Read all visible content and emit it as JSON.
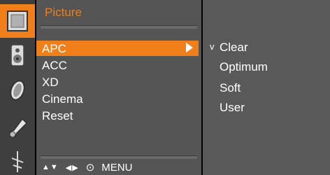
{
  "rail": {
    "icons": [
      {
        "name": "picture-icon",
        "active": true
      },
      {
        "name": "speaker-icon",
        "active": false
      },
      {
        "name": "clock-icon",
        "active": false
      },
      {
        "name": "wrench-icon",
        "active": false
      },
      {
        "name": "antenna-icon",
        "active": false
      }
    ],
    "accent_color": "#f07f1a"
  },
  "panel": {
    "title": "Picture",
    "items": [
      {
        "label": "APC",
        "selected": true
      },
      {
        "label": "ACC",
        "selected": false
      },
      {
        "label": "XD",
        "selected": false
      },
      {
        "label": "Cinema",
        "selected": false
      },
      {
        "label": "Reset",
        "selected": false
      }
    ],
    "nav_hint": {
      "updown": "▲▼",
      "leftright": "◀▶",
      "ok": "⊙",
      "menu": "MENU"
    }
  },
  "submenu": {
    "check_glyph": "v",
    "items": [
      {
        "label": "Clear",
        "checked": true
      },
      {
        "label": "Optimum",
        "checked": false
      },
      {
        "label": "Soft",
        "checked": false
      },
      {
        "label": "User",
        "checked": false
      }
    ]
  },
  "colors": {
    "accent": "#f07f1a",
    "panel": "#555555",
    "rail": "#3f3f3f"
  }
}
